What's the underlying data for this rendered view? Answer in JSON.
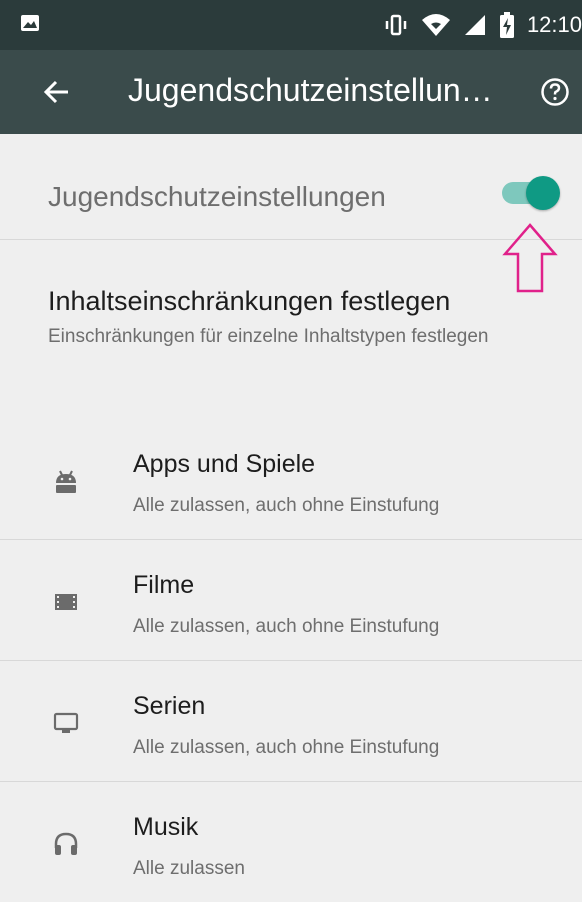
{
  "statusbar": {
    "time": "12:10"
  },
  "appbar": {
    "title": "Jugendschutzeinstellun…"
  },
  "master": {
    "label": "Jugendschutzeinstellungen",
    "enabled": true
  },
  "section": {
    "title": "Inhaltseinschränkungen festlegen",
    "description": "Einschränkungen für einzelne Inhaltstypen festlegen"
  },
  "items": [
    {
      "icon": "android-icon",
      "title": "Apps und Spiele",
      "subtitle": "Alle zulassen, auch ohne Einstufung"
    },
    {
      "icon": "film-icon",
      "title": "Filme",
      "subtitle": "Alle zulassen, auch ohne Einstufung"
    },
    {
      "icon": "tv-icon",
      "title": "Serien",
      "subtitle": "Alle zulassen, auch ohne Einstufung"
    },
    {
      "icon": "headphones-icon",
      "title": "Musik",
      "subtitle": "Alle zulassen"
    }
  ],
  "colors": {
    "accent": "#0f9a84",
    "annotation": "#e0218a",
    "appbar": "#3a4b4b"
  }
}
